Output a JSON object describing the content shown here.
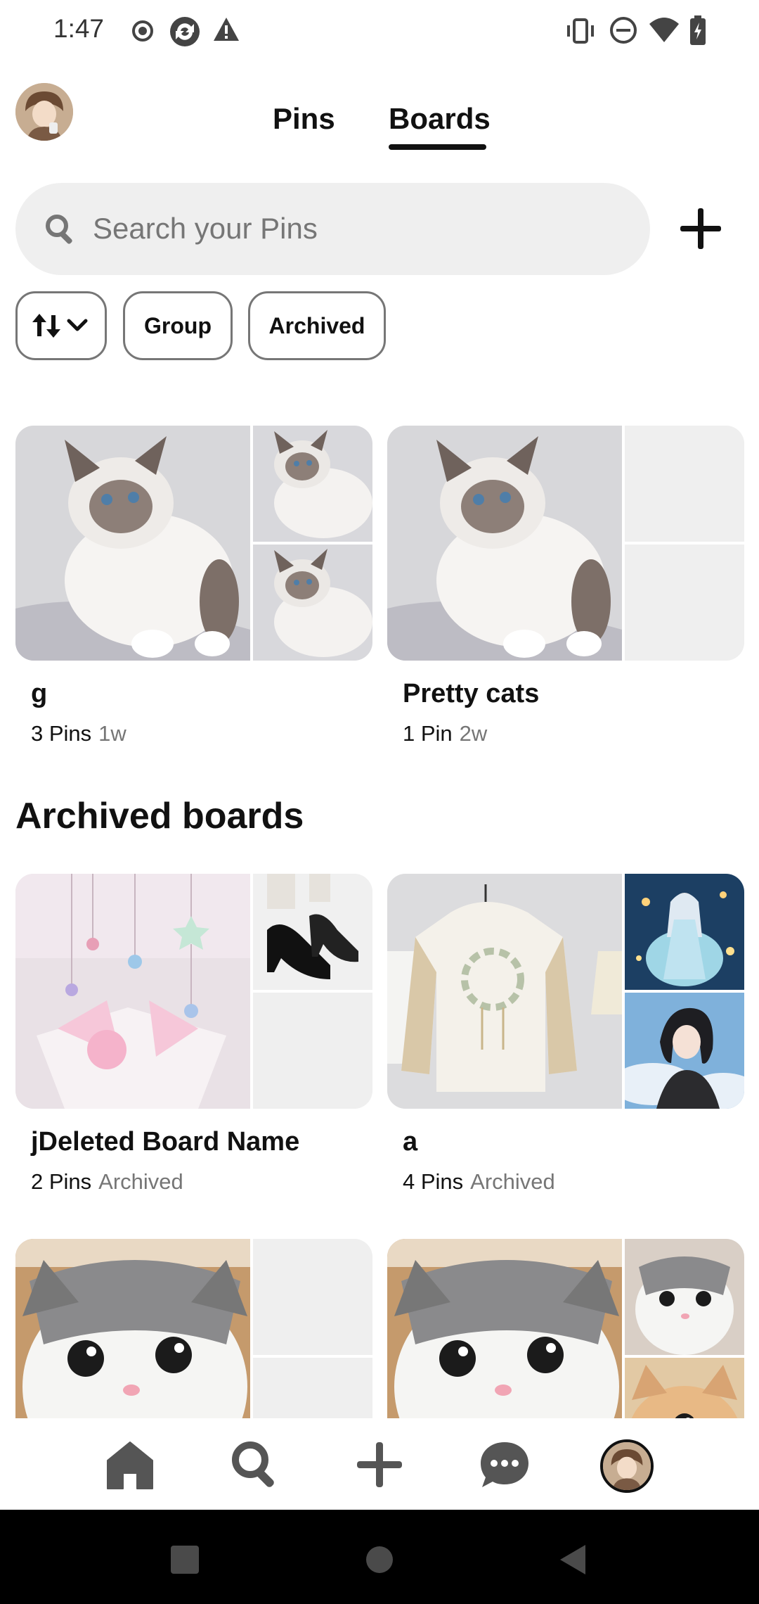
{
  "status_bar": {
    "time": "1:47"
  },
  "header": {
    "tabs": [
      {
        "label": "Pins",
        "active": false
      },
      {
        "label": "Boards",
        "active": true
      }
    ]
  },
  "search": {
    "placeholder": "Search your Pins"
  },
  "filters": {
    "group_label": "Group",
    "archived_label": "Archived"
  },
  "boards": [
    {
      "name": "g",
      "pin_count": "3 Pins",
      "age": "1w"
    },
    {
      "name": "Pretty cats",
      "pin_count": "1 Pin",
      "age": "2w"
    }
  ],
  "archived_section": {
    "title": "Archived boards",
    "boards": [
      {
        "name": "jDeleted Board Name",
        "pin_count": "2 Pins",
        "status": "Archived"
      },
      {
        "name": "a",
        "pin_count": "4 Pins",
        "status": "Archived"
      }
    ]
  },
  "bottom_nav": {
    "items": [
      "home-icon",
      "search-icon",
      "create-icon",
      "messages-icon",
      "profile-avatar"
    ]
  },
  "colors": {
    "text": "#111111",
    "secondary_text": "#767676",
    "search_bg": "#efefef"
  }
}
